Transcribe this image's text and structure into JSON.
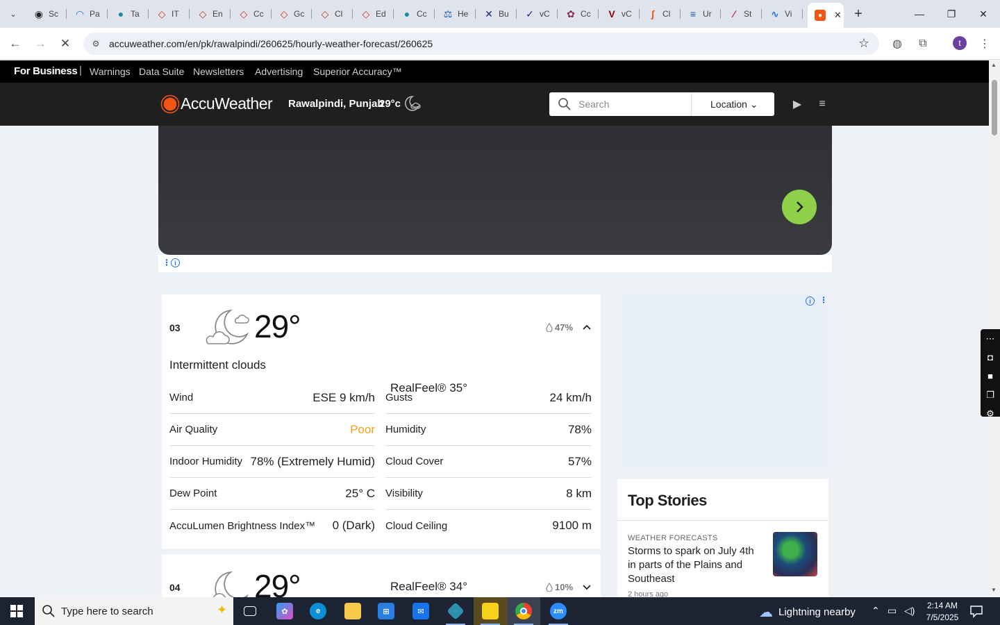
{
  "browser": {
    "tabs": [
      {
        "label": "Sc",
        "color": "#222222",
        "glyph": "◉"
      },
      {
        "label": "Pa",
        "color": "#1a73e8",
        "glyph": "◠"
      },
      {
        "label": "Ta",
        "color": "#1a8aa8",
        "glyph": "●"
      },
      {
        "label": "IT",
        "color": "#d93025",
        "glyph": "◇"
      },
      {
        "label": "En",
        "color": "#d93025",
        "glyph": "◇"
      },
      {
        "label": "Cc",
        "color": "#d93025",
        "glyph": "◇"
      },
      {
        "label": "Gc",
        "color": "#d93025",
        "glyph": "◇"
      },
      {
        "label": "Cl",
        "color": "#d93025",
        "glyph": "◇"
      },
      {
        "label": "Ed",
        "color": "#d93025",
        "glyph": "◇"
      },
      {
        "label": "Cc",
        "color": "#1a8aa8",
        "glyph": "●"
      },
      {
        "label": "He",
        "color": "#1a5fb4",
        "glyph": "⚖"
      },
      {
        "label": "Bu",
        "color": "#1a237e",
        "glyph": "✕"
      },
      {
        "label": "vC",
        "color": "#1a237e",
        "glyph": "✓"
      },
      {
        "label": "Cc",
        "color": "#8e2a5e",
        "glyph": "✿"
      },
      {
        "label": "vC",
        "color": "#8b0000",
        "glyph": "V"
      },
      {
        "label": "Cl",
        "color": "#e8590c",
        "glyph": "∫"
      },
      {
        "label": "Ur",
        "color": "#1a5fb4",
        "glyph": "≡"
      },
      {
        "label": "St",
        "color": "#c2185b",
        "glyph": "∕"
      },
      {
        "label": "Vi",
        "color": "#1a73e8",
        "glyph": "∿"
      }
    ],
    "active_tab_glyph": "●",
    "url": "accuweather.com/en/pk/rawalpindi/260625/hourly-weather-forecast/260625",
    "profile_initial": "t"
  },
  "site": {
    "bizbar": {
      "brand": "For Business",
      "links": [
        "Warnings",
        "Data Suite",
        "Newsletters",
        "Advertising",
        "Superior Accuracy™"
      ]
    },
    "logo": "AccuWeather",
    "location": "Rawalpindi, Punjab",
    "current_temp": "29°c",
    "search_placeholder": "Search",
    "location_button": "Location"
  },
  "hours": [
    {
      "hour": "03",
      "temp": "29°",
      "realfeel": "RealFeel® 35°",
      "precip": "47%",
      "phrase": "Intermittent clouds",
      "expanded": true,
      "left_rows": [
        {
          "label": "Wind",
          "value": "ESE 9 km/h"
        },
        {
          "label": "Air Quality",
          "value": "Poor"
        },
        {
          "label": "Indoor Humidity",
          "value": "78% (Extremely Humid)"
        },
        {
          "label": "Dew Point",
          "value": "25° C"
        },
        {
          "label": "AccuLumen Brightness Index™",
          "value": "0 (Dark)"
        }
      ],
      "right_rows": [
        {
          "label": "Gusts",
          "value": "24 km/h"
        },
        {
          "label": "Humidity",
          "value": "78%"
        },
        {
          "label": "Cloud Cover",
          "value": "57%"
        },
        {
          "label": "Visibility",
          "value": "8 km"
        },
        {
          "label": "Cloud Ceiling",
          "value": "9100 m"
        }
      ]
    },
    {
      "hour": "04",
      "temp": "29°",
      "realfeel": "RealFeel® 34°",
      "precip": "10%",
      "expanded": false
    }
  ],
  "top_stories": {
    "heading": "Top Stories",
    "items": [
      {
        "category": "WEATHER FORECASTS",
        "title": "Storms to spark on July 4th in parts of the Plains and Southeast",
        "time": "2 hours ago"
      }
    ]
  },
  "taskbar": {
    "search_placeholder": "Type here to search",
    "weather_text": "Lightning nearby",
    "time": "2:14 AM",
    "date": "7/5/2025"
  },
  "colors": {
    "accent_orange": "#f05514",
    "poor_aqi": "#f0a21a",
    "hero_next": "#8fd14a"
  }
}
